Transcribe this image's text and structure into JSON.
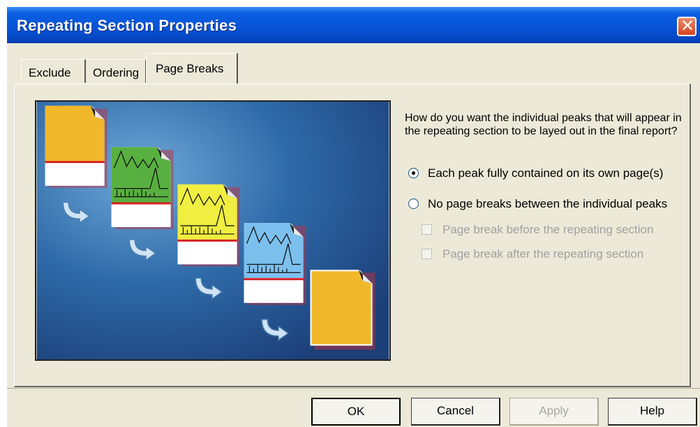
{
  "window": {
    "title": "Repeating Section Properties"
  },
  "tabs": [
    {
      "label": "Exclude",
      "active": false
    },
    {
      "label": "Ordering",
      "active": false
    },
    {
      "label": "Page Breaks",
      "active": true
    }
  ],
  "content": {
    "prompt": "How do you want the individual peaks that will appear in the repeating section to be layed out in the final report?",
    "options": [
      {
        "label": "Each peak fully contained on its own page(s)",
        "selected": true
      },
      {
        "label": "No page breaks between the individual peaks",
        "selected": false
      }
    ],
    "suboptions": [
      {
        "label": "Page break before the repeating section",
        "checked": false,
        "enabled": false
      },
      {
        "label": "Page break after the repeating section",
        "checked": false,
        "enabled": false
      }
    ]
  },
  "buttons": {
    "ok": "OK",
    "cancel": "Cancel",
    "apply": "Apply",
    "help": "Help"
  },
  "colors": {
    "titlebar": "#0854d8",
    "dialog_bg": "#ece9d8",
    "page_orange": "#f0b82a",
    "page_green": "#58b040",
    "page_yellow": "#f0ee40",
    "page_blue": "#7cc0ee",
    "red_stripe": "#d81e1e",
    "illustration_bg": "#1d5288"
  }
}
